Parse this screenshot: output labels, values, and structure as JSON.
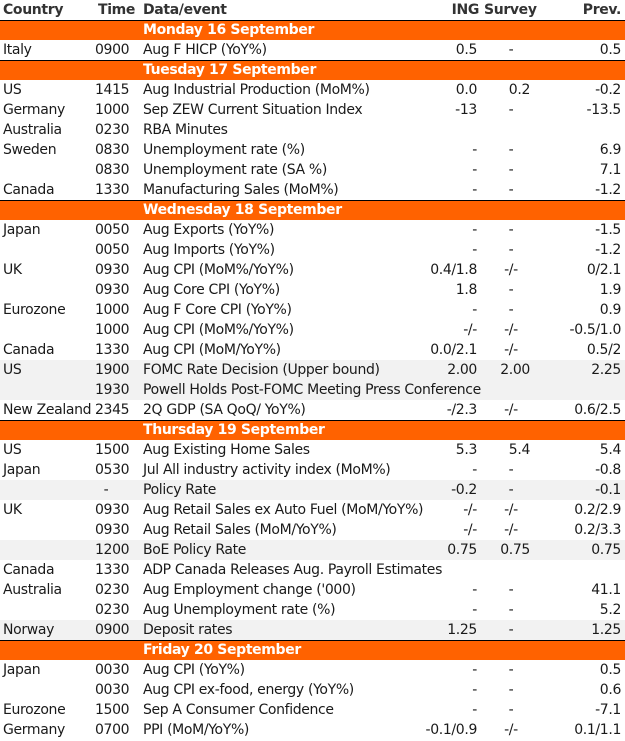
{
  "header": {
    "country": "Country",
    "time": "Time",
    "event": "Data/event",
    "ing": "ING",
    "survey": "Survey",
    "prev": "Prev."
  },
  "colors": {
    "accent": "#FF6200",
    "shaded_row": "#F2F2F2"
  },
  "days": [
    {
      "label": "Monday 16 September",
      "rows": [
        {
          "country": "Italy",
          "time": "0900",
          "event": "Aug F HICP (YoY%)",
          "ing": "0.5",
          "survey": "-",
          "prev": "0.5",
          "shaded": false
        }
      ]
    },
    {
      "label": "Tuesday 17 September",
      "rows": [
        {
          "country": "US",
          "time": "1415",
          "event": "Aug Industrial Production (MoM%)",
          "ing": "0.0",
          "survey": "0.2",
          "prev": "-0.2",
          "shaded": false
        },
        {
          "country": "Germany",
          "time": "1000",
          "event": "Sep ZEW Current Situation Index",
          "ing": "-13",
          "survey": "-",
          "prev": "-13.5",
          "shaded": false
        },
        {
          "country": "Australia",
          "time": "0230",
          "event": "RBA Minutes",
          "ing": "",
          "survey": "",
          "prev": "",
          "shaded": false
        },
        {
          "country": "Sweden",
          "time": "0830",
          "event": "Unemployment rate (%)",
          "ing": "-",
          "survey": "-",
          "prev": "6.9",
          "shaded": false
        },
        {
          "country": "",
          "time": "0830",
          "event": "Unemployment rate (SA %)",
          "ing": "-",
          "survey": "-",
          "prev": "7.1",
          "shaded": false
        },
        {
          "country": "Canada",
          "time": "1330",
          "event": "Manufacturing Sales (MoM%)",
          "ing": "-",
          "survey": "-",
          "prev": "-1.2",
          "shaded": false
        }
      ]
    },
    {
      "label": "Wednesday 18 September",
      "rows": [
        {
          "country": "Japan",
          "time": "0050",
          "event": "Aug Exports (YoY%)",
          "ing": "-",
          "survey": "-",
          "prev": "-1.5",
          "shaded": false
        },
        {
          "country": "",
          "time": "0050",
          "event": "Aug Imports (YoY%)",
          "ing": "-",
          "survey": "-",
          "prev": "-1.2",
          "shaded": false
        },
        {
          "country": "UK",
          "time": "0930",
          "event": "Aug CPI (MoM%/YoY%)",
          "ing": "0.4/1.8",
          "survey": "-/-",
          "prev": "0/2.1",
          "shaded": false
        },
        {
          "country": "",
          "time": "0930",
          "event": "Aug Core CPI (YoY%)",
          "ing": "1.8",
          "survey": "-",
          "prev": "1.9",
          "shaded": false
        },
        {
          "country": "Eurozone",
          "time": "1000",
          "event": "Aug F Core CPI (YoY%)",
          "ing": "-",
          "survey": "-",
          "prev": "0.9",
          "shaded": false
        },
        {
          "country": "",
          "time": "1000",
          "event": "Aug CPI (MoM%/YoY%)",
          "ing": "-/-",
          "survey": "-/-",
          "prev": "-0.5/1.0",
          "shaded": false
        },
        {
          "country": "Canada",
          "time": "1330",
          "event": "Aug CPI (MoM/YoY%)",
          "ing": "0.0/2.1",
          "survey": "-/-",
          "prev": "0.5/2",
          "shaded": false
        },
        {
          "country": "US",
          "time": "1900",
          "event": "FOMC Rate Decision (Upper bound)",
          "ing": "2.00",
          "survey": "2.00",
          "prev": "2.25",
          "shaded": true
        },
        {
          "country": "",
          "time": "1930",
          "event": "Powell Holds Post-FOMC Meeting Press Conference",
          "ing": "",
          "survey": "",
          "prev": "",
          "shaded": true
        },
        {
          "country": "New Zealand",
          "time": "2345",
          "event": "2Q GDP (SA QoQ/ YoY%)",
          "ing": "-/2.3",
          "survey": "-/-",
          "prev": "0.6/2.5",
          "shaded": false
        }
      ]
    },
    {
      "label": "Thursday 19 September",
      "rows": [
        {
          "country": "US",
          "time": "1500",
          "event": "Aug Existing Home Sales",
          "ing": "5.3",
          "survey": "5.4",
          "prev": "5.4",
          "shaded": false
        },
        {
          "country": "Japan",
          "time": "0530",
          "event": "Jul All industry activity index (MoM%)",
          "ing": "-",
          "survey": "-",
          "prev": "-0.8",
          "shaded": false
        },
        {
          "country": "",
          "time": "-",
          "event": "Policy Rate",
          "ing": "-0.2",
          "survey": "-",
          "prev": "-0.1",
          "shaded": true
        },
        {
          "country": "UK",
          "time": "0930",
          "event": "Aug Retail Sales ex Auto Fuel (MoM/YoY%)",
          "ing": "-/-",
          "survey": "-/-",
          "prev": "0.2/2.9",
          "shaded": false
        },
        {
          "country": "",
          "time": "0930",
          "event": "Aug Retail Sales (MoM/YoY%)",
          "ing": "-/-",
          "survey": "-/-",
          "prev": "0.2/3.3",
          "shaded": false
        },
        {
          "country": "",
          "time": "1200",
          "event": "BoE Policy Rate",
          "ing": "0.75",
          "survey": "0.75",
          "prev": "0.75",
          "shaded": true
        },
        {
          "country": "Canada",
          "time": "1330",
          "event": "ADP Canada Releases Aug. Payroll Estimates",
          "ing": "",
          "survey": "",
          "prev": "",
          "shaded": false
        },
        {
          "country": "Australia",
          "time": "0230",
          "event": "Aug Employment change ('000)",
          "ing": "-",
          "survey": "-",
          "prev": "41.1",
          "shaded": false
        },
        {
          "country": "",
          "time": "0230",
          "event": "Aug Unemployment rate (%)",
          "ing": "-",
          "survey": "-",
          "prev": "5.2",
          "shaded": false
        },
        {
          "country": "Norway",
          "time": "0900",
          "event": "Deposit rates",
          "ing": "1.25",
          "survey": "-",
          "prev": "1.25",
          "shaded": true
        }
      ]
    },
    {
      "label": "Friday 20 September",
      "rows": [
        {
          "country": "Japan",
          "time": "0030",
          "event": "Aug CPI (YoY%)",
          "ing": "-",
          "survey": "-",
          "prev": "0.5",
          "shaded": false
        },
        {
          "country": "",
          "time": "0030",
          "event": "Aug CPI ex-food, energy (YoY%)",
          "ing": "-",
          "survey": "-",
          "prev": "0.6",
          "shaded": false
        },
        {
          "country": "Eurozone",
          "time": "1500",
          "event": "Sep A Consumer Confidence",
          "ing": "-",
          "survey": "-",
          "prev": "-7.1",
          "shaded": false
        },
        {
          "country": "Germany",
          "time": "0700",
          "event": "PPI (MoM/YoY%)",
          "ing": "-0.1/0.9",
          "survey": "-/-",
          "prev": "0.1/1.1",
          "shaded": false
        }
      ]
    }
  ]
}
